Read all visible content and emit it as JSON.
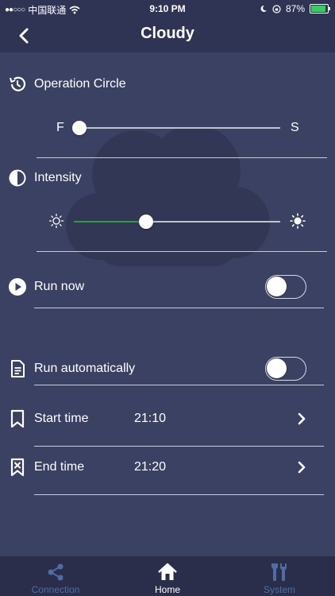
{
  "status_bar": {
    "carrier": "中国联通",
    "signal_dots": "●●○○○",
    "time": "9:10 PM",
    "battery": "87%"
  },
  "header": {
    "title": "Cloudy"
  },
  "operation_circle": {
    "label": "Operation Circle",
    "min_label": "F",
    "max_label": "S",
    "value_fraction": 0.0
  },
  "intensity": {
    "label": "Intensity",
    "value_fraction": 0.35
  },
  "run_now": {
    "label": "Run now",
    "on": false
  },
  "run_automatically": {
    "label": "Run automatically",
    "on": false
  },
  "start_time": {
    "label": "Start time",
    "value": "21:10"
  },
  "end_time": {
    "label": "End time",
    "value": "21:20"
  },
  "tab_bar": {
    "tabs": [
      {
        "label": "Connection",
        "icon": "share-icon",
        "active": false
      },
      {
        "label": "Home",
        "icon": "home-icon",
        "active": true
      },
      {
        "label": "System",
        "icon": "tools-icon",
        "active": false
      }
    ]
  },
  "colors": {
    "background": "#3b4163",
    "bar": "#2f3454",
    "accent_green": "#2e9b3c",
    "inactive_tab": "#4d6ea5"
  }
}
